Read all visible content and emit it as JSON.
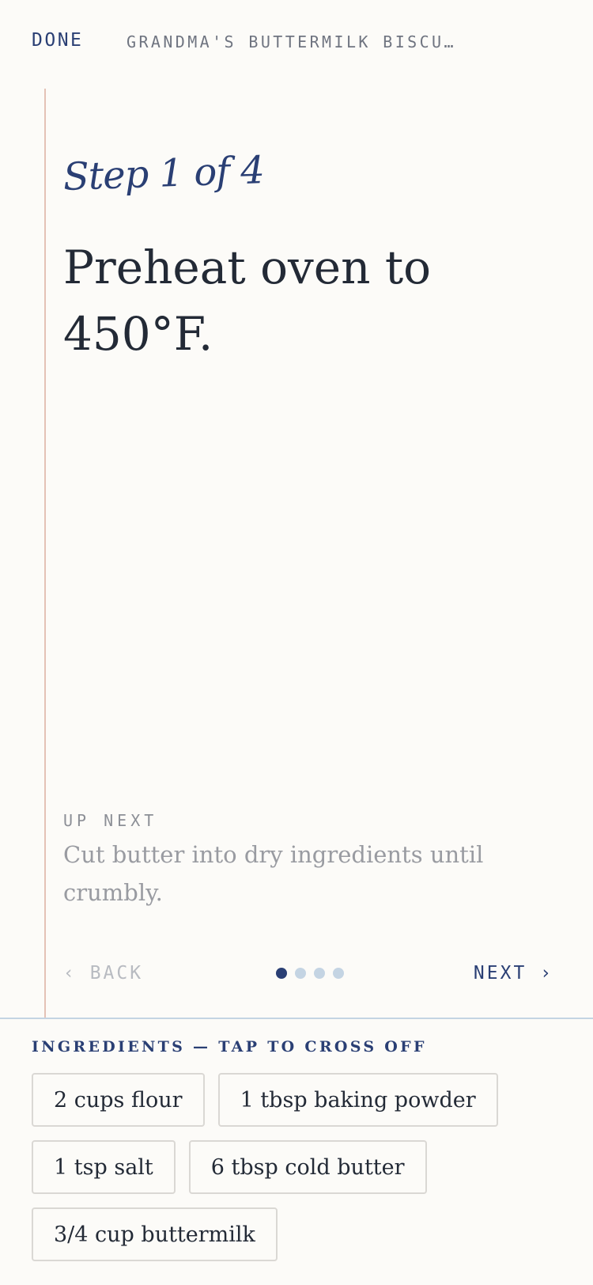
{
  "header": {
    "done_label": "DONE",
    "recipe_title": "GRANDMA'S BUTTERMILK BISCU…"
  },
  "step": {
    "label": "Step 1 of 4",
    "current": 1,
    "total": 4,
    "instruction": "Preheat oven to 450°F."
  },
  "up_next": {
    "label": "UP NEXT",
    "text": "Cut butter into dry ingredients until crumbly."
  },
  "nav": {
    "back_label": "‹ BACK",
    "next_label": "NEXT ›",
    "back_enabled": false
  },
  "ingredients": {
    "header": "INGREDIENTS — TAP TO CROSS OFF",
    "items": [
      "2 cups flour",
      "1 tbsp baking powder",
      "1 tsp salt",
      "6 tbsp cold butter",
      "3/4 cup buttermilk"
    ]
  },
  "colors": {
    "accent": "#2a3f74",
    "margin_line": "#e4c2b6",
    "dot_inactive": "#c4d4e3",
    "background": "#fcfbf8"
  }
}
